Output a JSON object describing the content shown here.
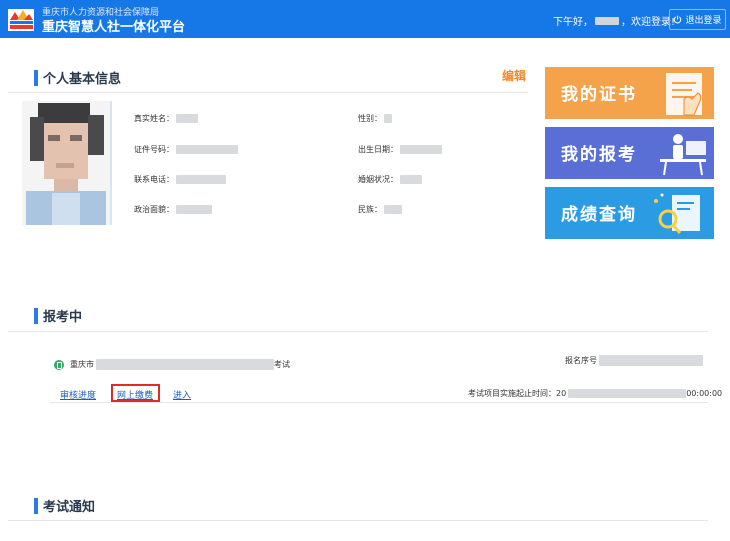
{
  "header": {
    "org_small": "重庆市人力资源和社会保障局",
    "org_big": "重庆智慧人社一体化平台",
    "greeting_prefix": "下午好，",
    "greeting_suffix": "，欢迎登录!",
    "logout_label": "退出登录"
  },
  "profile": {
    "section_title": "个人基本信息",
    "edit_label": "编辑",
    "fields": {
      "name_label": "真实姓名：",
      "gender_label": "性别：",
      "id_label": "证件号码：",
      "birth_label": "出生日期：",
      "phone_label": "联系电话：",
      "marital_label": "婚姻状况：",
      "political_label": "政治面貌：",
      "ethnic_label": "民族："
    }
  },
  "cards": [
    {
      "label": "我的证书",
      "color": "#f5a34a"
    },
    {
      "label": "我的报考",
      "color": "#5a6fd6"
    },
    {
      "label": "成绩查询",
      "color": "#2b9be3"
    }
  ],
  "exam": {
    "section_title": "报考中",
    "exam_prefix": "重庆市",
    "exam_suffix": "考试",
    "serial_label": "报名序号",
    "progress_link": "审核进度",
    "pay_link": "网上缴费",
    "enter_link": "进入",
    "time_label": "考试项目实施起止时间：",
    "time_start": "20",
    "time_end": "00:00:00"
  },
  "notice": {
    "section_title": "考试通知"
  },
  "colors": {
    "header_bg": "#1677e6",
    "accent_blue": "#2c7be5",
    "edit_orange": "#f08a2a",
    "highlight_red": "#e12a2a"
  }
}
